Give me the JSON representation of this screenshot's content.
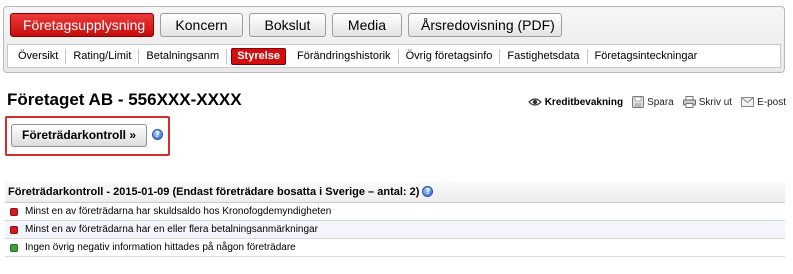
{
  "main_tabs": [
    {
      "label": "Företagsupplysning",
      "active": true
    },
    {
      "label": "Koncern",
      "active": false
    },
    {
      "label": "Bokslut",
      "active": false
    },
    {
      "label": "Media",
      "active": false
    },
    {
      "label": "Årsredovisning (PDF)",
      "active": false
    }
  ],
  "sub_tabs": [
    {
      "label": "Översikt",
      "active": false
    },
    {
      "label": "Rating/Limit",
      "active": false
    },
    {
      "label": "Betalningsanm",
      "active": false
    },
    {
      "label": "Styrelse",
      "active": true
    },
    {
      "label": "Förändringshistorik",
      "active": false
    },
    {
      "label": "Övrig företagsinfo",
      "active": false
    },
    {
      "label": "Fastighetsdata",
      "active": false
    },
    {
      "label": "Företagsinteckningar",
      "active": false
    }
  ],
  "company": {
    "title": "Företaget AB - 556XXX-XXXX"
  },
  "actions": {
    "kreditbevakning": "Kreditbevakning",
    "spara": "Spara",
    "skriv_ut": "Skriv ut",
    "epost": "E-post"
  },
  "kontroll_button": {
    "label": "Företrädarkontroll »"
  },
  "results": {
    "header": "Företrädarkontroll - 2015-01-09 (Endast företrädare bosatta i Sverige – antal: 2)",
    "rows": [
      {
        "text": "Minst en av företrädarna har skuldsaldo hos Kronofogdemyndigheten",
        "status": "red"
      },
      {
        "text": "Minst en av företrädarna har en eller flera betalningsanmärkningar",
        "status": "red"
      },
      {
        "text": "Ingen övrig negativ information hittades på någon företrädare",
        "status": "green"
      }
    ]
  },
  "colors": {
    "red": "#d7191c",
    "green": "#3aa33a",
    "accent": "#d20e0e",
    "highlight_border": "#d62b2b"
  },
  "icons": {
    "kreditbevakning": "eye-icon",
    "spara": "save-icon",
    "skriv_ut": "printer-icon",
    "epost": "envelope-icon",
    "help": "help-icon"
  }
}
